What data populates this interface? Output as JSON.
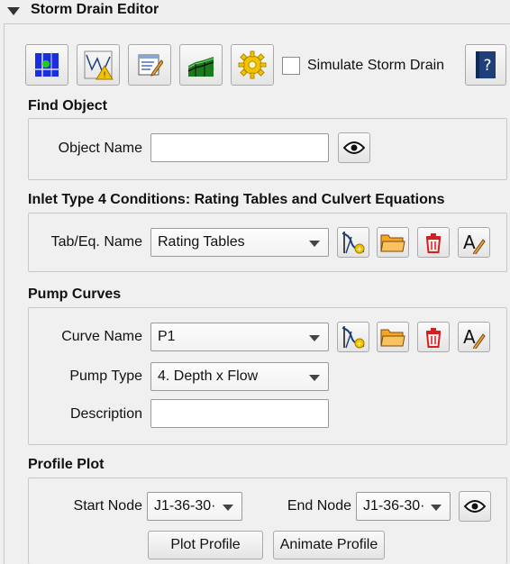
{
  "header": {
    "title": "Storm Drain Editor"
  },
  "toolbar": {
    "buttons": [
      {
        "icon": "node-grid-icon"
      },
      {
        "icon": "network-warning-icon"
      },
      {
        "icon": "edit-form-icon"
      },
      {
        "icon": "terrain-profile-icon"
      },
      {
        "icon": "settings-gear-icon"
      }
    ],
    "simulate_label": "Simulate Storm Drain",
    "simulate_checked": false,
    "help_label": "?"
  },
  "find_object": {
    "title": "Find Object",
    "name_label": "Object Name",
    "name_value": ""
  },
  "inlet": {
    "title": "Inlet Type 4 Conditions: Rating Tables and Culvert Equations",
    "tab_label": "Tab/Eq. Name",
    "tab_value": "Rating Tables"
  },
  "pump": {
    "title": "Pump Curves",
    "curve_label": "Curve Name",
    "curve_value": "P1",
    "type_label": "Pump Type",
    "type_value": "4. Depth x Flow",
    "description_label": "Description",
    "description_value": ""
  },
  "profile": {
    "title": "Profile Plot",
    "start_label": "Start Node",
    "start_value": "J1-36-30·",
    "end_label": "End Node",
    "end_value": "J1-36-30·",
    "plot_button": "Plot Profile",
    "animate_button": "Animate Profile"
  },
  "colors": {
    "accent_blue": "#1f3f7a",
    "folder_orange": "#f5a623",
    "trash_red": "#d62020"
  }
}
